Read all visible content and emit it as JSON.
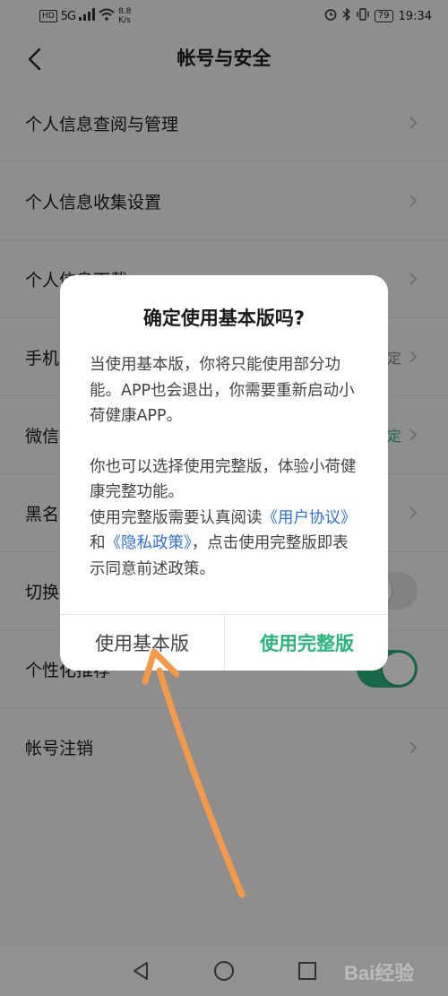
{
  "status_bar": {
    "hd": "HD",
    "net_type": "5G",
    "speed": "8.8",
    "speed_unit": "K/s",
    "battery": "79",
    "time": "19:34"
  },
  "header": {
    "title": "帐号与安全",
    "back_icon": "chevron-left-icon"
  },
  "settings": {
    "items": [
      {
        "label": "个人信息查阅与管理",
        "value": "",
        "control": "chevron"
      },
      {
        "label": "个人信息收集设置",
        "value": "",
        "control": "chevron"
      },
      {
        "label": "个人信息下载",
        "value": "",
        "control": "chevron"
      },
      {
        "label": "手机",
        "value": "定",
        "control": "chevron"
      },
      {
        "label": "微信",
        "value": "定",
        "control": "chevron"
      },
      {
        "label": "黑名",
        "value": "",
        "control": "chevron"
      },
      {
        "label": "切换",
        "value": "",
        "control": "toggle-off"
      },
      {
        "label": "个性化推荐",
        "value": "",
        "control": "toggle-on"
      },
      {
        "label": "帐号注销",
        "value": "",
        "control": "chevron"
      }
    ]
  },
  "dialog": {
    "title": "确定使用基本版吗?",
    "para1": "当使用基本版，你将只能使用部分功能。APP也会退出，你需要重新启动小荷健康APP。",
    "para2": "你也可以选择使用完整版，体验小荷健康完整功能。",
    "para3_pre": "使用完整版需要认真阅读",
    "link_user": "《用户协议》",
    "para3_and": "和",
    "link_privacy": "《隐私政策》",
    "para3_post": "，点击使用完整版即表示同意前述政策。",
    "btn_basic": "使用基本版",
    "btn_full": "使用完整版"
  },
  "colors": {
    "accent": "#2bb57c",
    "link": "#2f6fd1",
    "annotation_arrow": "#f39a4a"
  },
  "watermark": "Bai经验"
}
